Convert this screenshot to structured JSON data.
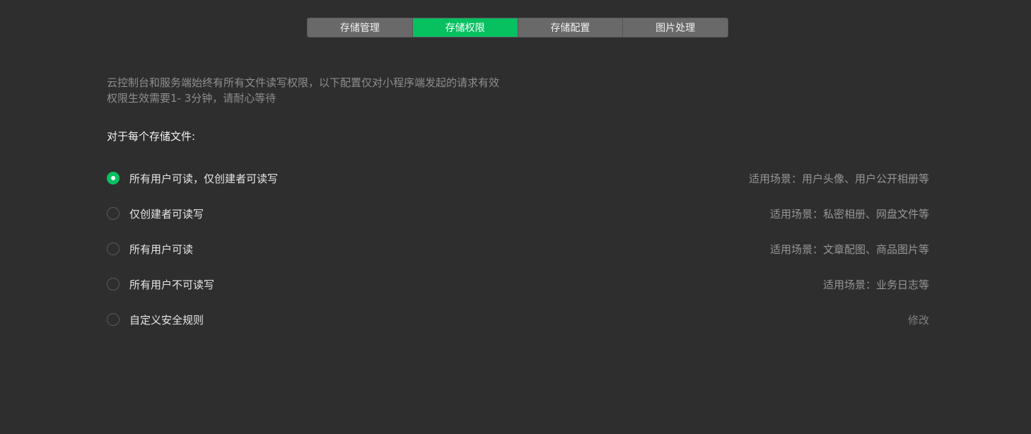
{
  "tabs": [
    {
      "label": "存储管理",
      "active": false
    },
    {
      "label": "存储权限",
      "active": true
    },
    {
      "label": "存储配置",
      "active": false
    },
    {
      "label": "图片处理",
      "active": false
    }
  ],
  "notice": {
    "line1": "云控制台和服务端始终有所有文件读写权限，以下配置仅对小程序端发起的请求有效",
    "line2": "权限生效需要1- 3分钟，请耐心等待"
  },
  "section_title": "对于每个存储文件:",
  "options": [
    {
      "label": "所有用户可读，仅创建者可读写",
      "desc": "适用场景：用户头像、用户公开相册等",
      "checked": true
    },
    {
      "label": "仅创建者可读写",
      "desc": "适用场景：私密相册、网盘文件等",
      "checked": false
    },
    {
      "label": "所有用户可读",
      "desc": "适用场景：文章配图、商品图片等",
      "checked": false
    },
    {
      "label": "所有用户不可读写",
      "desc": "适用场景：业务日志等",
      "checked": false
    },
    {
      "label": "自定义安全规则",
      "link": "修改",
      "checked": false
    }
  ],
  "colors": {
    "accent": "#07c160",
    "background": "#2e2e2e",
    "tab_inactive": "#696969"
  }
}
